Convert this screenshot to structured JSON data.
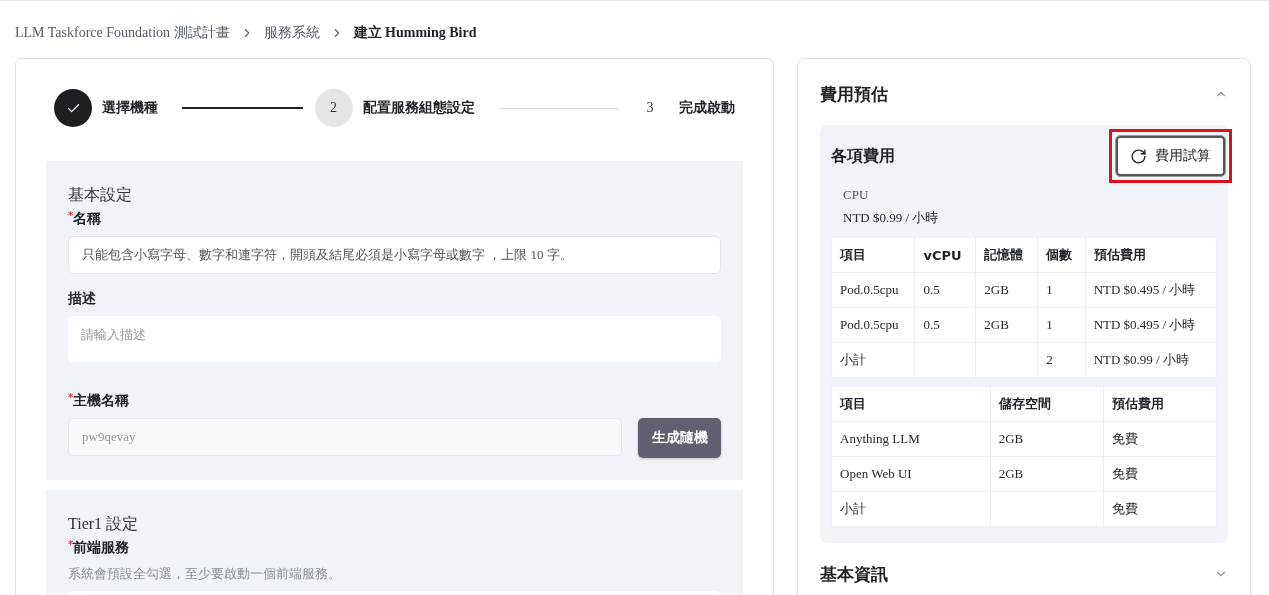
{
  "breadcrumb": [
    {
      "label": "LLM Taskforce Foundation 測試計畫",
      "current": false
    },
    {
      "label": "服務系統",
      "current": false
    },
    {
      "label": "建立 Humming Bird",
      "current": true
    }
  ],
  "steps": [
    {
      "label": "選擇機種",
      "completed": true,
      "selected": false
    },
    {
      "number": "2",
      "label": "配置服務組態設定",
      "completed": false,
      "selected": true
    },
    {
      "number": "3",
      "label": "完成啟動",
      "completed": false,
      "selected": false
    }
  ],
  "basic_settings": {
    "title": "基本設定",
    "fields": [
      {
        "label": "名稱",
        "required_mark": "*",
        "kind": "input",
        "placeholder": "只能包含小寫字母、數字和連字符，開頭及結尾必須是小寫字母或數字 ，上限 10 字。"
      },
      {
        "label": "描述",
        "kind": "textarea",
        "placeholder": "請輸入描述"
      },
      {
        "label": "主機名稱",
        "required_mark": "*",
        "kind": "input-button",
        "value": "pw9qevay",
        "button": "生成隨機"
      }
    ]
  },
  "tier1": {
    "title": "Tier1 設定",
    "field_label": "前端服務",
    "required_mark": "*",
    "hint": "系統會預設全勾選，至少要啟動一個前端服務。"
  },
  "cost_panel": {
    "title": "費用預估",
    "expanded": true,
    "card_title": "各項費用",
    "recalc_button": "費用試算",
    "highlighted": true,
    "cpu_label": "CPU",
    "cpu_total": "NTD $0.99 / 小時",
    "cpu_table": {
      "columns": [
        "項目",
        "vCPU",
        "記憶體",
        "個數",
        "預估費用"
      ],
      "rows": [
        [
          "Pod.0.5cpu",
          "0.5",
          "2GB",
          "1",
          "NTD $0.495 / 小時"
        ],
        [
          "Pod.0.5cpu",
          "0.5",
          "2GB",
          "1",
          "NTD $0.495 / 小時"
        ],
        [
          "小計",
          "",
          "",
          "2",
          "NTD $0.99 / 小時"
        ]
      ]
    },
    "storage_table": {
      "columns": [
        "項目",
        "儲存空間",
        "預估費用"
      ],
      "rows": [
        [
          "Anything LLM",
          "2GB",
          "免費"
        ],
        [
          "Open Web UI",
          "2GB",
          "免費"
        ],
        [
          "小計",
          "",
          "免費"
        ]
      ]
    }
  },
  "info_panel": {
    "title": "基本資訊",
    "expanded": false
  }
}
